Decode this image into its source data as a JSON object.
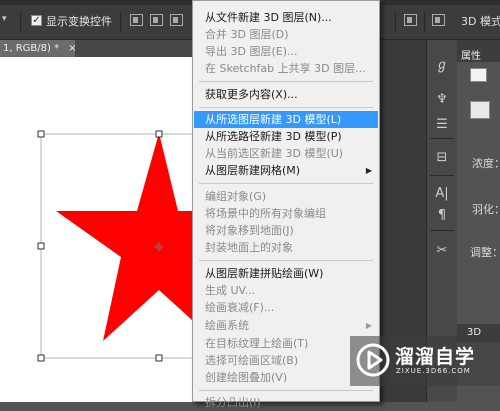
{
  "options_bar": {
    "dropdown_glyph": "▾",
    "show_transform_controls": {
      "checked": true,
      "label": "显示变换控件"
    },
    "mode_3d_label": "3D 模式"
  },
  "document_tab": {
    "label": "1, RGB/8) *",
    "close_glyph": "×"
  },
  "menu": {
    "items": [
      {
        "label": "从文件新建 3D 图层(N)...",
        "enabled": true
      },
      {
        "label": "合并 3D 图层(D)",
        "enabled": false
      },
      {
        "label": "导出 3D 图层(E)...",
        "enabled": false
      },
      {
        "label": "在 Sketchfab 上共享 3D 图层...",
        "enabled": false
      },
      {
        "label": "获取更多内容(X)...",
        "enabled": true
      },
      {
        "label": "从所选图层新建 3D 模型(L)",
        "enabled": true,
        "highlighted": true
      },
      {
        "label": "从所选路径新建 3D 模型(P)",
        "enabled": true
      },
      {
        "label": "从当前选区新建 3D 模型(U)",
        "enabled": false
      },
      {
        "label": "从图层新建网格(M)",
        "enabled": true,
        "submenu": true
      },
      {
        "label": "编组对象(G)",
        "enabled": false
      },
      {
        "label": "将场景中的所有对象编组",
        "enabled": false
      },
      {
        "label": "将对象移到地面(J)",
        "enabled": false
      },
      {
        "label": "封装地面上的对象",
        "enabled": false
      },
      {
        "label": "从图层新建拼贴绘画(W)",
        "enabled": true
      },
      {
        "label": "生成 UV...",
        "enabled": false
      },
      {
        "label": "绘画衰减(F)...",
        "enabled": false
      },
      {
        "label": "绘画系统",
        "enabled": false,
        "submenu": true
      },
      {
        "label": "在目标纹理上绘画(T)",
        "enabled": false
      },
      {
        "label": "选择可绘画区域(B)",
        "enabled": false
      },
      {
        "label": "创建绘图叠加(V)",
        "enabled": false
      },
      {
        "label": "拆分凸出(I)",
        "enabled": false
      }
    ],
    "submenu_arrow": "▶"
  },
  "properties_panel": {
    "tab_label": "属性",
    "density_label": "浓度：",
    "feather_label": "羽化：",
    "adjust_label": "调整：",
    "bottom_tab_label": "3D"
  },
  "toolstrip": {
    "icons": [
      "adjust-curve-icon",
      "paint-brush-icon",
      "sliders-icon",
      "layers-icon",
      "character-icon",
      "paragraph-icon",
      "tools-icon"
    ]
  },
  "watermark": {
    "brand": "溜溜自学",
    "url": "ZIXUE.3D66.COM"
  },
  "colors": {
    "star_fill": "#ff0000",
    "menu_highlight": "#3399ff",
    "canvas": "#ffffff"
  }
}
